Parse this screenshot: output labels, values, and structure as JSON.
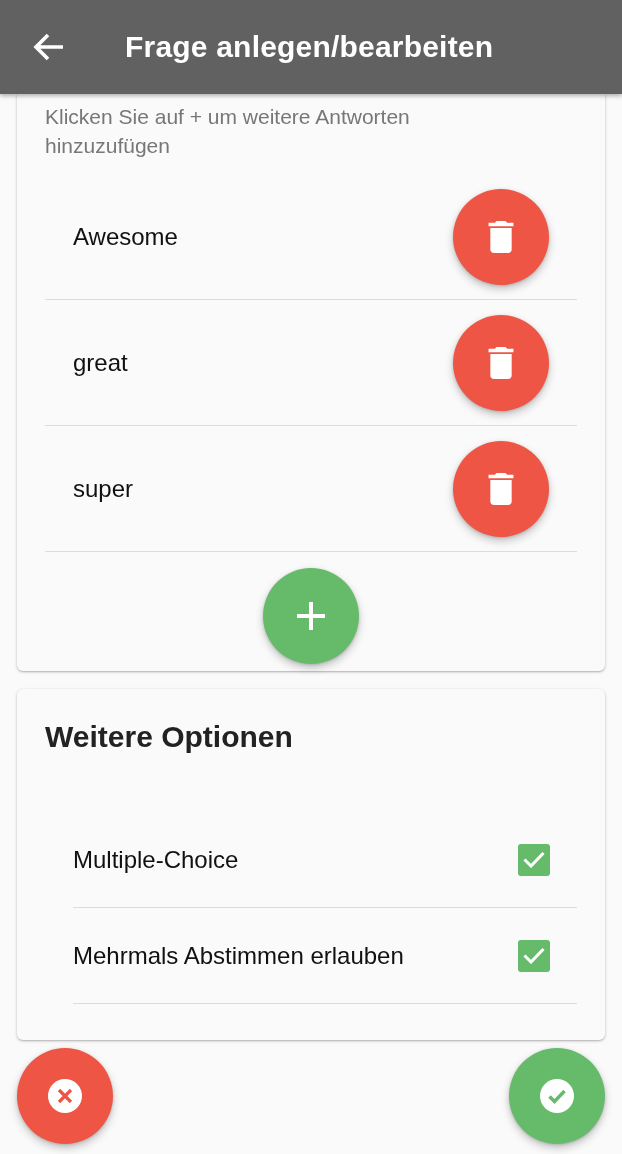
{
  "app_bar": {
    "title": "Frage anlegen/bearbeiten"
  },
  "answers_card": {
    "hint": "Klicken Sie auf + um weitere Antworten hinzuzufügen",
    "answers": [
      {
        "text": "Awesome"
      },
      {
        "text": "great"
      },
      {
        "text": "super"
      }
    ]
  },
  "options_card": {
    "title": "Weitere Optionen",
    "options": [
      {
        "label": "Multiple-Choice",
        "checked": true
      },
      {
        "label": "Mehrmals Abstimmen erlauben",
        "checked": true
      }
    ]
  }
}
